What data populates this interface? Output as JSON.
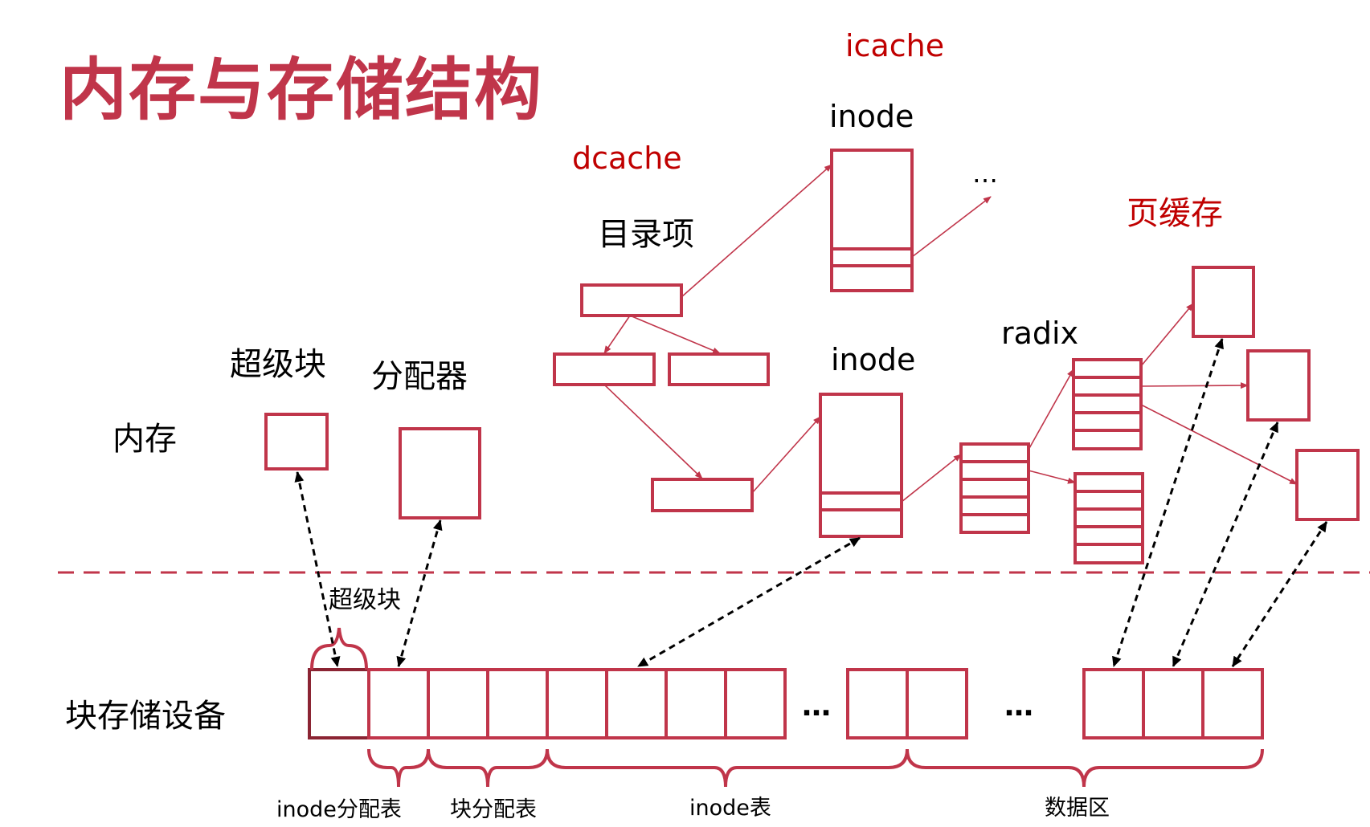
{
  "colors": {
    "accent": "#c0354a",
    "dark_accent": "#8b2433",
    "text": "#000000"
  },
  "title": "内存与存储结构",
  "labels": {
    "icache": "icache",
    "dcache": "dcache",
    "page_cache": "页缓存",
    "inode_top": "inode",
    "inode_mid": "inode",
    "dentry": "目录项",
    "radix": "radix",
    "superblock_mem": "超级块",
    "allocator": "分配器",
    "memory": "内存",
    "superblock_disk": "超级块",
    "block_device": "块存储设备",
    "ellipsis_icache": "…",
    "ellipsis_blocks_1": "…",
    "ellipsis_blocks_2": "…"
  },
  "regions": {
    "inode_alloc_table": "inode分配表",
    "block_alloc_table": "块分配表",
    "inode_table": "inode表",
    "data_area": "数据区"
  }
}
